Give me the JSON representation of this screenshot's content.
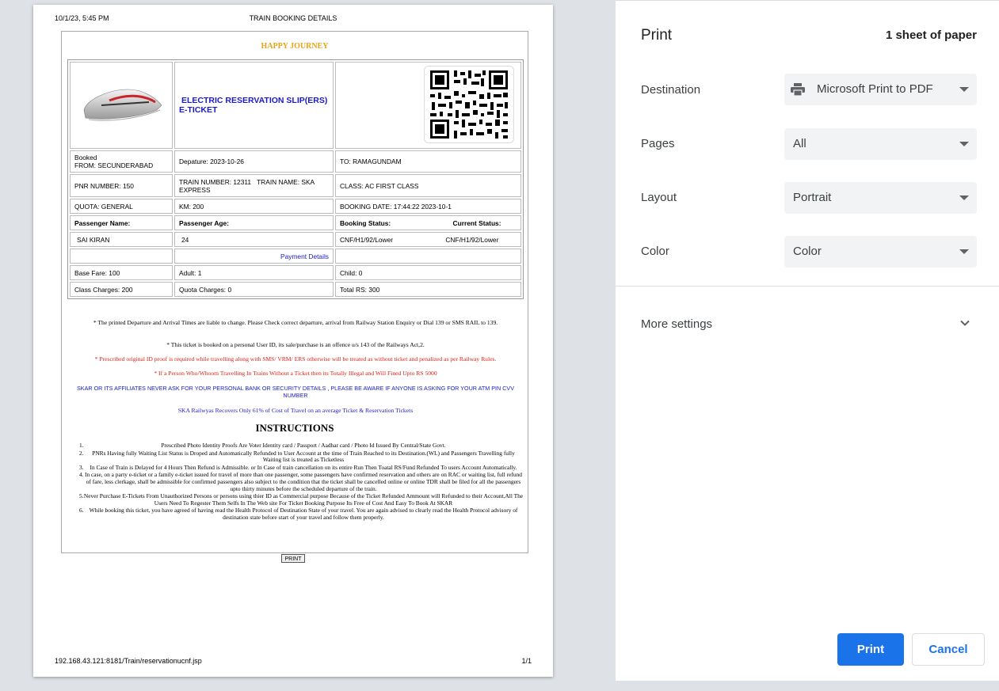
{
  "page_header": {
    "datetime": "10/1/23, 5:45 PM",
    "title": "TRAIN BOOKING DETAILS"
  },
  "page_footer": {
    "url": "192.168.43.121:8181/Train/reservationucnf.jsp",
    "page_num": "1/1"
  },
  "ticket": {
    "greeting": "HAPPY JOURNEY",
    "slip_title_line1": "ELECTRIC RESERVATION SLIP(ERS)",
    "slip_title_line2": "E-TICKET",
    "booked_label": "Booked",
    "from": "FROM: SECUNDERABAD",
    "departure": "Depature: 2023-10-26",
    "to": "TO: RAMAGUNDAM",
    "pnr": "PNR NUMBER: 150",
    "train_number": "TRAIN NUMBER: 12311",
    "train_name": "TRAIN NAME: SKA EXPRESS",
    "class": "CLASS: AC FIRST CLASS",
    "quota": "QUOTA: GENERAL",
    "km": "KM: 200",
    "booking_date": "BOOKING DATE: 17:44:22 2023-10-1",
    "headers": {
      "passenger_name": "Passenger Name:",
      "passenger_age": "Passenger Age:",
      "booking_status": "Booking Status:",
      "current_status": "Current Status:"
    },
    "passenger": {
      "name": "SAI KIRAN",
      "age": "24",
      "booking_status": "CNF/H1/92/Lower",
      "current_status": "CNF/H1/92/Lower"
    },
    "payment_details_label": "Payment Details",
    "base_fare": "Base Fare:  100",
    "adult": "Adult:  1",
    "child": "Child:  0",
    "class_charges": "Class Charges:  200",
    "quota_charges": "Quota Charges:  0",
    "total": "Total RS:  300",
    "print_button": "PRINT"
  },
  "notes": [
    "* The printed Departure and Arrival Times are liable to change. Please Check correct departure, arrival from Railway Station Enquiry or Dial 139 or SMS RAIL to 139.",
    "* This ticket is booked on a personal User ID, its sale/purchase is an offence u/s 143 of the Railways Act,2.",
    "* Prescribed original ID proof is required while travelling along with SMS/ VRM/ ERS otherwise will be treated as without ticket and penalized as per Railway Rules.",
    "* If a Person Who/Whoom Travelling In Trains Without a Ticket then its Totally Illegal and Will Fined Upto RS 5000",
    "SKAR OR ITS AFFILIATES NEVER ASK FOR YOUR PERSONAL BANK OR SECURITY DETAILS , PLEASE BE AWARE IF ANYONE IS ASKING FOR YOUR ATM PIN CVV NUMBER",
    "SKA Railwyas Recovers Only 61% of Cost of Travel on an average Ticket & Reservation Tickets"
  ],
  "instructions": {
    "title": "INSTRUCTIONS",
    "items": [
      {
        "num": "1.",
        "text": "Prescribed Photo Identity Proofs Are Voter Identity card / Passport / Aadhar card / Photo Id Issued By Central/State Govt."
      },
      {
        "num": "2.",
        "text": "PNRs Having fully Waiting List Status is Droped and Automatically Refunded to User Account at the time of Train Reached to its Destination.(WL) and Passengers Travelling fully Waiting list is treated as Ticketless"
      },
      {
        "num": "3.",
        "text": "In Case of Train is Delayed for 4 Hours Then Refund is Admissible. or In Case of train cancellation on its entire Run Then Toatal RS/Fund Refunded To users Account Automatically."
      },
      {
        "num": "4.",
        "text": "In case, on a party e-ticket or a family e-ticket issued for travel of more than one passenger, some passengers have confirmed reservation and others are on RAC or waiting list, full refund of fare, less clerkage, shall be admissible for confirmed passengers also subject to the condition that the ticket shall be cancelled online or online TDR shall be filed for all the passengers upto thirty minutes before the scheduled departure of the train."
      },
      {
        "num": "5.",
        "text": "Never Purchase E-Tickets From Unauthorized Persons or persons using thier ID as Commercial purpose Because of the Ticket Refunded Ammount will Refunded to their Account,All The Users Need To Regester Them Selfs In The Web site For Ticket Booking Purpose Its Free of Cost And Easy To Book At SKAR"
      },
      {
        "num": "6.",
        "text": "While booking this ticket, you have agreed of having read the Health Protocol of Destination State of your travel. You are again advised to clearly read the Health Protocol advisory of destination state before start of your travel and follow them properly."
      }
    ]
  },
  "print_panel": {
    "title": "Print",
    "sheet_count": "1 sheet of paper",
    "destination_label": "Destination",
    "destination_value": "Microsoft Print to PDF",
    "pages_label": "Pages",
    "pages_value": "All",
    "layout_label": "Layout",
    "layout_value": "Portrait",
    "color_label": "Color",
    "color_value": "Color",
    "more_settings": "More settings",
    "print_button": "Print",
    "cancel_button": "Cancel"
  },
  "icons": {
    "train": "train-image",
    "qr": "qr-code-image",
    "printer": "printer-icon",
    "chevron": "chevron-down-icon"
  },
  "colors": {
    "accent": "#1a73e8",
    "greeting": "#e8a317",
    "warning": "#e0221a",
    "info": "#1a1acd"
  }
}
